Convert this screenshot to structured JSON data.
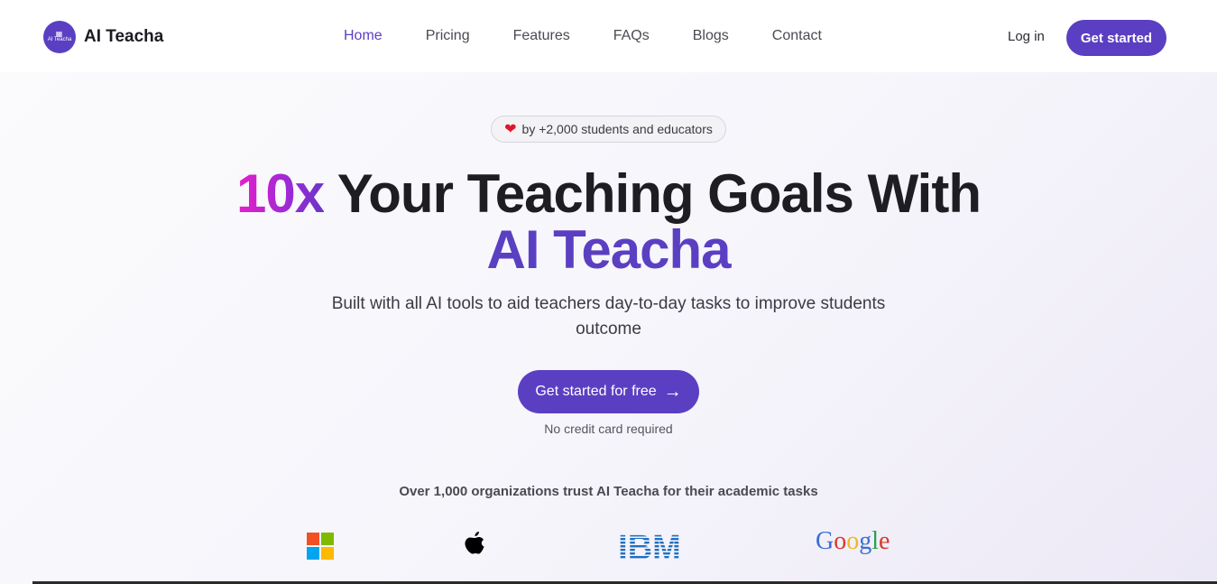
{
  "brand": {
    "name": "AI Teacha",
    "logo_text": "AI Teacha"
  },
  "nav": {
    "items": [
      {
        "label": "Home",
        "active": true
      },
      {
        "label": "Pricing",
        "active": false
      },
      {
        "label": "Features",
        "active": false
      },
      {
        "label": "FAQs",
        "active": false
      },
      {
        "label": "Blogs",
        "active": false
      },
      {
        "label": "Contact",
        "active": false
      }
    ],
    "login_label": "Log in",
    "get_started_label": "Get started"
  },
  "hero": {
    "badge_text": "by +2,000 students and educators",
    "headline_highlight": "10x",
    "headline_rest": " Your Teaching Goals With",
    "headline_brand": "AI Teacha",
    "subtitle": "Built with all AI tools to aid teachers day-to-day tasks to improve students outcome",
    "cta_label": "Get started for free",
    "cta_note": "No credit card required",
    "trust_text": "Over 1,000 organizations trust AI Teacha for their academic tasks"
  },
  "trusted_logos": [
    {
      "name": "microsoft-logo"
    },
    {
      "name": "apple-logo"
    },
    {
      "name": "ibm-logo",
      "text": "IBM"
    },
    {
      "name": "google-logo",
      "text": "Google"
    }
  ],
  "colors": {
    "accent": "#5b3fc2",
    "gradient_start": "#e61fc9",
    "gradient_end": "#6a35c9",
    "heart": "#e0162b"
  }
}
